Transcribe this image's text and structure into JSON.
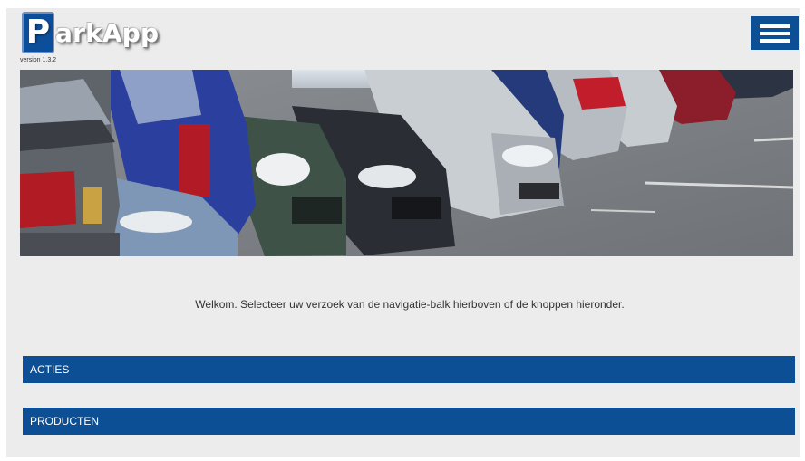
{
  "app": {
    "name": "ParkApp",
    "logo_letter": "P",
    "logo_rest": "arkApp",
    "version": "version 1.3.2"
  },
  "header": {
    "menu_icon": "hamburger-menu-icon"
  },
  "banner": {
    "subject": "parked cars photo"
  },
  "main": {
    "welcome": "Welkom. Selecteer uw verzoek van de navigatie-balk hierboven of de knoppen hieronder.",
    "buttons": [
      {
        "label": "ACTIES"
      },
      {
        "label": "PRODUCTEN"
      }
    ]
  },
  "colors": {
    "brand_blue": "#0c4f94",
    "page_bg": "#ececec"
  }
}
